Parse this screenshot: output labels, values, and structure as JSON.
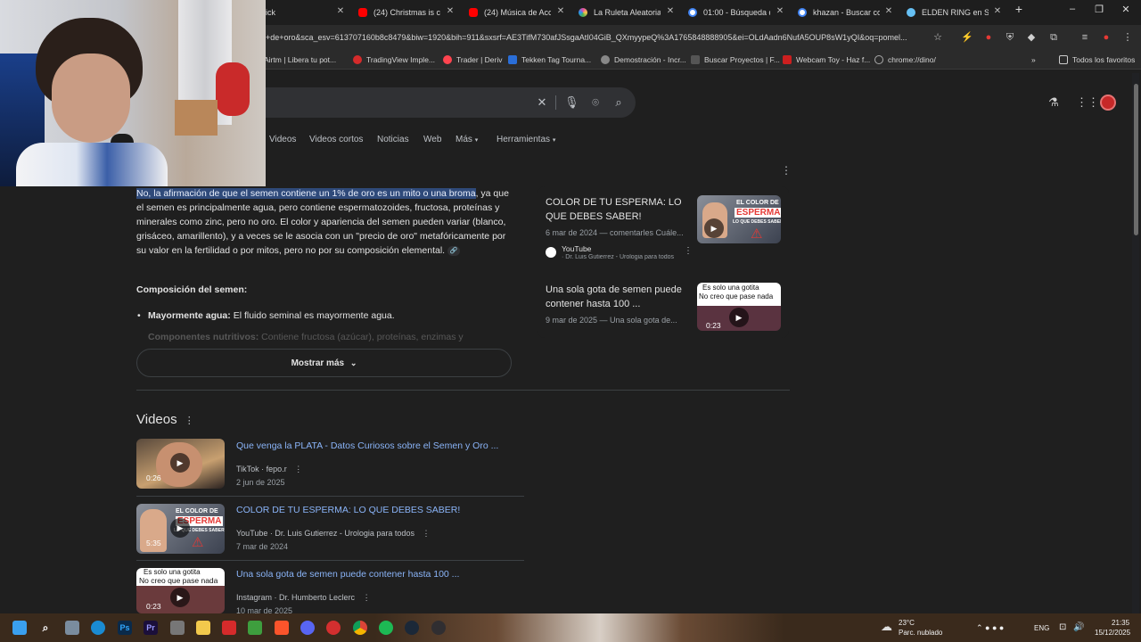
{
  "browser": {
    "tabs": [
      {
        "label": "ick",
        "icon": "google-icon",
        "color": "#4285f4"
      },
      {
        "label": "(24) Christmas is com",
        "icon": "youtube-icon",
        "color": "#ff0000"
      },
      {
        "label": "(24) Música de Acció",
        "icon": "youtube-icon",
        "color": "#ff0000"
      },
      {
        "label": "La Ruleta Aleatoria",
        "icon": "wheel-icon",
        "color": "#e24ba6"
      },
      {
        "label": "01:00 - Búsqueda de",
        "icon": "google-icon",
        "color": "#4285f4"
      },
      {
        "label": "khazan - Buscar con",
        "icon": "google-icon",
        "color": "#4285f4"
      },
      {
        "label": "ELDEN RING en Stea",
        "icon": "steam-icon",
        "color": "#66c0f4"
      }
    ],
    "new_tab": "+",
    "url": "+de+oro&sca_esv=613707160b8c8479&biw=1920&bih=911&sxsrf=AE3TifM730afJSsgaAtI04GiB_QXmyypeQ%3A1765848888905&ei=OLdAadn6NufA5OUP8sW1yQI&oq=pomel...",
    "bookmarks": [
      {
        "label": "Airtm | Libera tu pot...",
        "color": "#2b6ff7"
      },
      {
        "label": "TradingView Imple...",
        "color": "#d52b2b"
      },
      {
        "label": "Trader | Deriv",
        "color": "#ff444f"
      },
      {
        "label": "Tekken Tag Tourna...",
        "color": "#2a6ed8"
      },
      {
        "label": "Demostración - Incr...",
        "color": "#888888"
      },
      {
        "label": "Buscar Proyectos | F...",
        "color": "#555555"
      },
      {
        "label": "Webcam Toy - Haz f...",
        "color": "#cc1f1f"
      },
      {
        "label": "chrome://dino/",
        "color": "#aaaaaa"
      }
    ],
    "all_bookmarks": "Todos los favoritos"
  },
  "google": {
    "nav_tabs": [
      "Videos",
      "Videos cortos",
      "Noticias",
      "Web",
      "Más",
      "Herramientas"
    ],
    "overview": {
      "highlight": "No, la afirmación de que el semen contiene un 1% de oro es un mito o una broma",
      "rest": ", ya que el semen es principalmente agua, pero contiene espermatozoides, fructosa, proteínas y minerales como zinc, pero no oro. El color y apariencia del semen pueden variar (blanco, grisáceo, amarillento), y a veces se le asocia con un \"precio de oro\" metafóricamente por su valor en la fertilidad o por mitos, pero no por su composición elemental.",
      "section_title": "Composición del semen:",
      "bullet1_bold": "Mayormente agua:",
      "bullet1_text": " El fluido seminal es mayormente agua.",
      "bullet2_bold": "Componentes nutritivos:",
      "bullet2_text": " Contiene fructosa (azúcar), proteínas, enzimas y",
      "show_more": "Mostrar más"
    },
    "sources": [
      {
        "title": "COLOR DE TU ESPERMA: LO QUE DEBES SABER!",
        "meta": "6 mar de 2024 — comentarles Cuále...",
        "site": "YouTube",
        "author": "· Dr. Luis Gutierrez - Urologia para todos",
        "thumb_text1": "EL COLOR DE",
        "thumb_text2": "ESPERMA",
        "thumb_text3": "LO QUE DEBES SABER",
        "thumb_dur": "5:35"
      },
      {
        "title": "Una sola gota de semen puede contener hasta 100 ...",
        "meta": "9 mar de 2025 — Una sola gota de...",
        "thumb_text1": "Es solo una gotita",
        "thumb_text2": "No creo que pase nada",
        "thumb_dur": "0:23"
      }
    ],
    "videos_heading": "Videos",
    "videos": [
      {
        "title": "Que venga la PLATA - Datos Curiosos sobre el Semen y Oro ...",
        "platform": "TikTok",
        "channel": "fepo.r",
        "date": "2 jun de 2025",
        "duration": "0:26"
      },
      {
        "title": "COLOR DE TU ESPERMA: LO QUE DEBES SABER!",
        "platform": "YouTube",
        "channel": "Dr. Luis Gutierrez - Urologia para todos",
        "date": "7 mar de 2024",
        "duration": "5:35"
      },
      {
        "title": "Una sola gota de semen puede contener hasta 100 ...",
        "platform": "Instagram",
        "channel": "Dr. Humberto Leclerc",
        "date": "10 mar de 2025",
        "duration": "0:23"
      }
    ]
  },
  "taskbar": {
    "weather_temp": "23°C",
    "weather_desc": "Parc. nublado",
    "lang": "ENG",
    "time": "21:35",
    "date": "15/12/2025"
  }
}
